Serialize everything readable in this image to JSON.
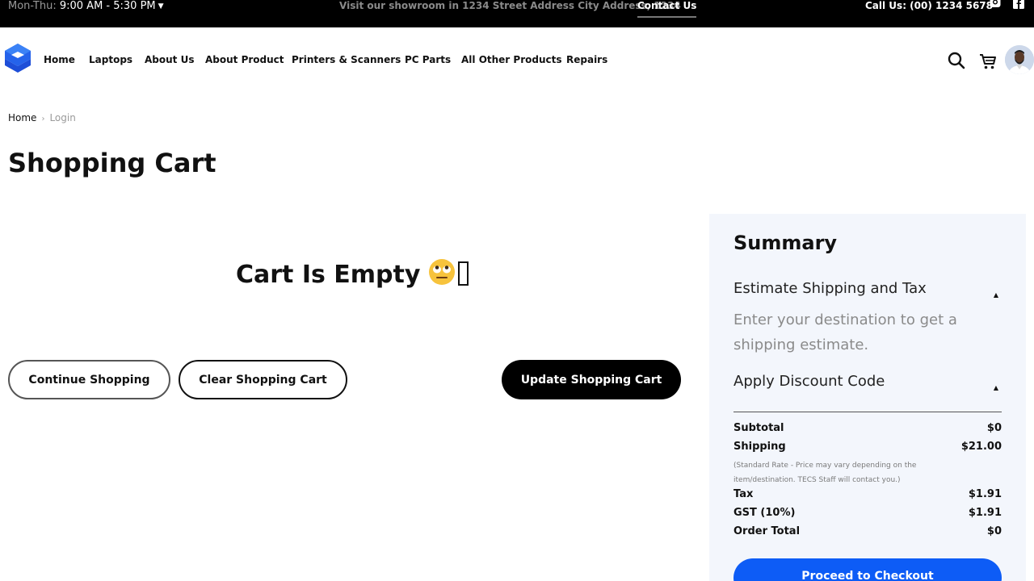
{
  "topbar": {
    "hours_label": "Mon-Thu:",
    "hours_value": "9:00 AM - 5:30 PM",
    "visit_text": "Visit our showroom in 1234 Street Address City Address, 1234",
    "contact_label": "Contact Us",
    "call_text": "Call Us: (00) 1234 5678"
  },
  "nav": {
    "items": [
      "Home",
      "Laptops",
      "About Us",
      "About Product",
      "Printers & Scanners",
      "PC Parts",
      "All Other Products",
      "Repairs"
    ]
  },
  "breadcrumb": {
    "home": "Home",
    "current": "Login"
  },
  "page_title": "Shopping Cart",
  "cart": {
    "empty_message": "Cart Is Empty",
    "continue_label": "Continue Shopping",
    "clear_label": "Clear Shopping Cart",
    "update_label": "Update Shopping Cart"
  },
  "summary": {
    "title": "Summary",
    "shipping_toggle": "Estimate Shipping and Tax",
    "shipping_hint": "Enter your destination to get a shipping estimate.",
    "discount_toggle": "Apply Discount Code",
    "rows": [
      {
        "label": "Subtotal",
        "value": "$0"
      },
      {
        "label": "Shipping",
        "value": "$21.00"
      },
      {
        "label": "Tax",
        "value": "$1.91"
      },
      {
        "label": "GST (10%)",
        "value": "$1.91"
      },
      {
        "label": "Order Total",
        "value": "$0"
      }
    ],
    "shipping_note": "(Standard Rate - Price may vary depending on the item/destination. TECS Staff will contact you.)",
    "checkout_label": "Proceed to Checkout"
  },
  "colors": {
    "accent": "#0d5cf6",
    "summary_bg": "#f3f6fc",
    "topbar_bg": "#000000"
  }
}
